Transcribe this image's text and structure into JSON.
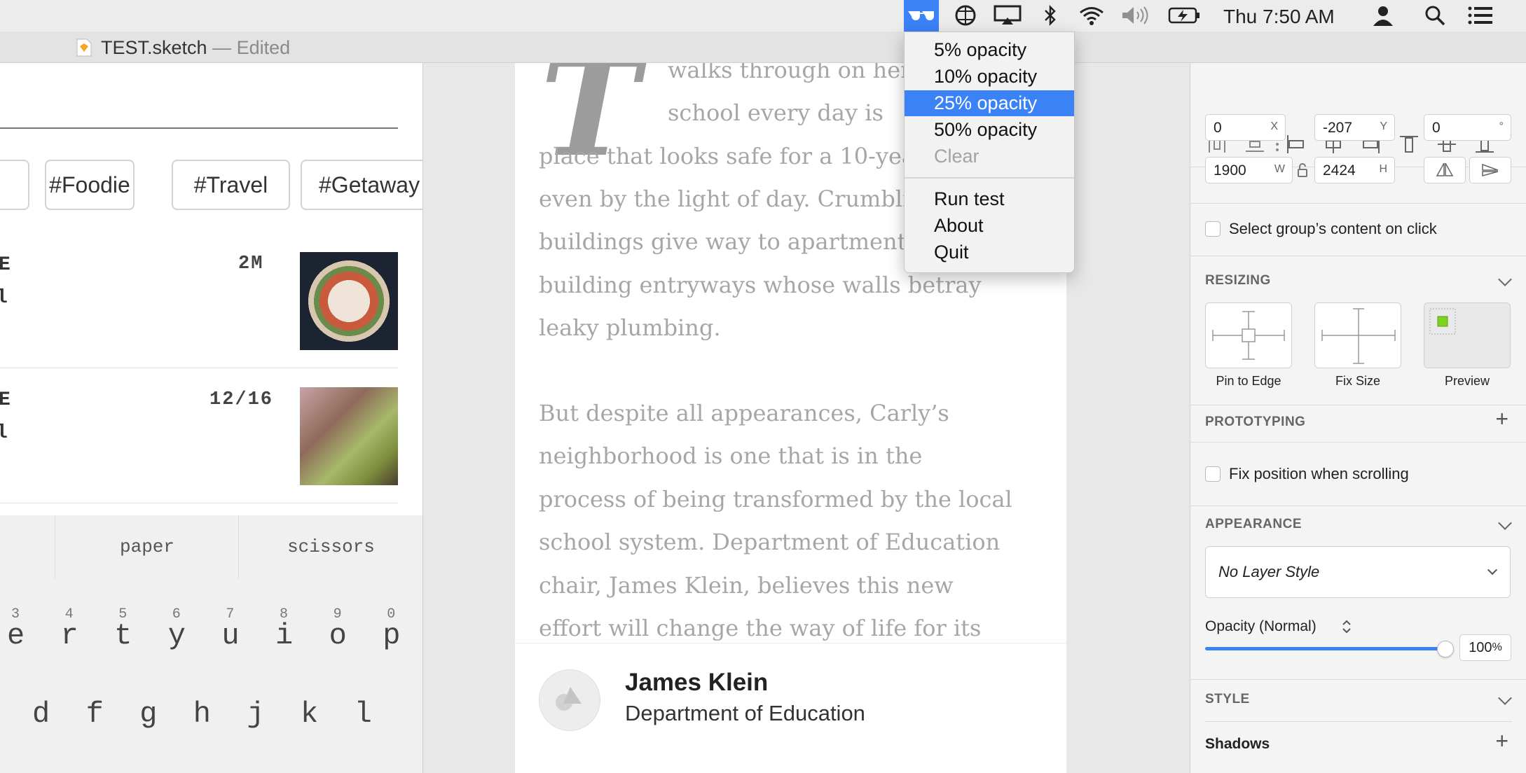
{
  "window": {
    "title": "TEST.sketch",
    "edited": "— Edited"
  },
  "menubar": {
    "clock": "Thu 7:50 AM",
    "icons": [
      "glasses-icon",
      "globe-icon",
      "airplay-icon",
      "bluetooth-icon",
      "wifi-icon",
      "volume-icon",
      "battery-icon",
      "user-icon",
      "spotlight-icon",
      "notification-list-icon"
    ],
    "active_color": "#3b82f6"
  },
  "dropdown": {
    "items": [
      {
        "label": "5% opacity",
        "state": "normal"
      },
      {
        "label": "10% opacity",
        "state": "normal"
      },
      {
        "label": "25% opacity",
        "state": "selected"
      },
      {
        "label": "50% opacity",
        "state": "normal"
      },
      {
        "label": "Clear",
        "state": "disabled"
      },
      {
        "label": "Run test",
        "state": "normal"
      },
      {
        "label": "About",
        "state": "normal"
      },
      {
        "label": "Quit",
        "state": "normal"
      }
    ]
  },
  "left_artboard": {
    "tags": [
      "#Foodie",
      "#Travel",
      "#Getaway"
    ],
    "feed": [
      {
        "title_fragment": "E",
        "meta": "2M",
        "sub_fragment": "l"
      },
      {
        "title_fragment": "E",
        "meta": "12/16",
        "sub_fragment": "l"
      }
    ],
    "keyboard": {
      "suggestions": [
        "paper",
        "scissors"
      ],
      "numbers": [
        "3",
        "4",
        "5",
        "6",
        "7",
        "8",
        "9",
        "0"
      ],
      "row1": [
        "e",
        "r",
        "t",
        "y",
        "u",
        "i",
        "o",
        "p"
      ],
      "row2": [
        "d",
        "f",
        "g",
        "h",
        "j",
        "k",
        "l"
      ]
    }
  },
  "article": {
    "dropcap": "T",
    "lines": [
      "walks through on her way to",
      "school every day is",
      "place that looks safe for a 10-year-old,",
      "even by the light of day. Crumbling",
      "buildings give way to apartment",
      "building entryways whose walls betray",
      "leaky plumbing."
    ],
    "paragraph2": [
      "But despite all appearances, Carly’s",
      "neighborhood is one that is in the",
      "process of being transformed by the local",
      "school system. Department of Education",
      "chair, James Klein,  believes this new",
      "effort will change the way of life for its"
    ],
    "byline": {
      "name": "James Klein",
      "org": "Department of Education"
    }
  },
  "inspector": {
    "position": {
      "x": "0",
      "y": "-207",
      "rotation": "0",
      "x_label": "X",
      "y_label": "Y",
      "rot_label": "°"
    },
    "size": {
      "w": "1900",
      "h": "2424",
      "w_label": "W",
      "h_label": "H"
    },
    "select_group_label": "Select group’s content on click",
    "resizing": {
      "header": "RESIZING",
      "options": [
        "Pin to Edge",
        "Fix Size",
        "Preview"
      ]
    },
    "prototyping": {
      "header": "PROTOTYPING",
      "fix_position_label": "Fix position when scrolling"
    },
    "appearance": {
      "header": "APPEARANCE",
      "layer_style": "No Layer Style",
      "opacity_label": "Opacity (Normal)",
      "opacity_value": "100",
      "opacity_unit": "%",
      "opacity_fraction": 1.0
    },
    "style": {
      "header": "STYLE",
      "shadows_label": "Shadows"
    }
  }
}
